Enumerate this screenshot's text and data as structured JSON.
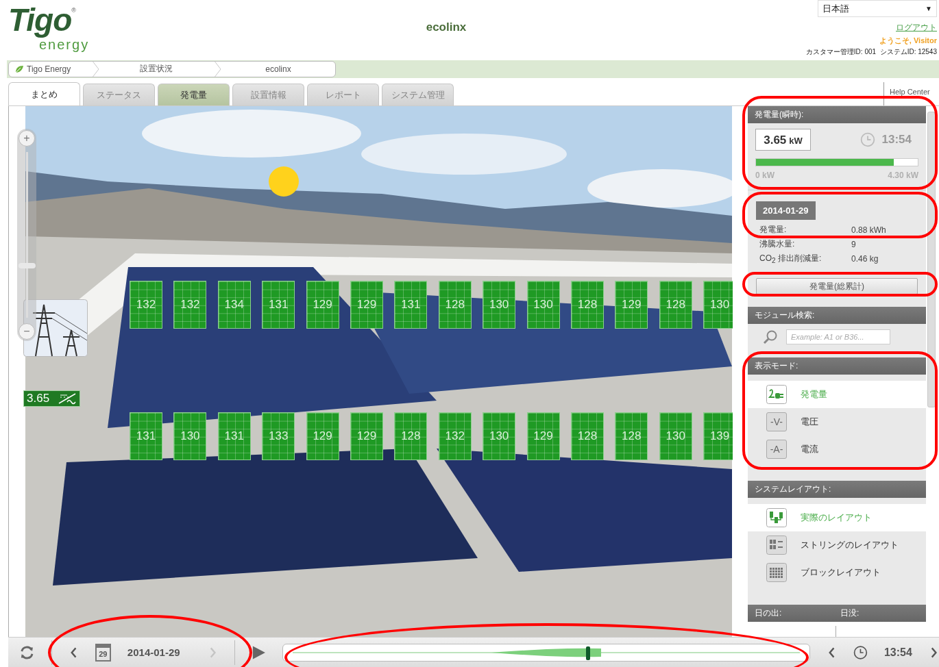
{
  "header": {
    "logo": {
      "wordmark": "Tigo",
      "registered": "®",
      "tagline": "energy"
    },
    "title": "ecolinx",
    "language": "日本語",
    "language_caret": "▼",
    "logout": "ログアウト",
    "welcome": "ようこそ, Visitor",
    "ids": "カスタマー管理ID: 001  システムID: 12543"
  },
  "breadcrumb": [
    "Tigo Energy",
    "設置状況",
    "ecolinx"
  ],
  "tabs": [
    {
      "label": "まとめ",
      "selected": true,
      "highlighted": false,
      "disabled": false
    },
    {
      "label": "ステータス",
      "selected": false,
      "highlighted": false,
      "disabled": true
    },
    {
      "label": "発電量",
      "selected": false,
      "highlighted": true,
      "disabled": false
    },
    {
      "label": "設置情報",
      "selected": false,
      "highlighted": false,
      "disabled": true
    },
    {
      "label": "レポート",
      "selected": false,
      "highlighted": false,
      "disabled": true
    },
    {
      "label": "システム管理",
      "selected": false,
      "highlighted": false,
      "disabled": true
    }
  ],
  "help_center": "Help Center",
  "map": {
    "zoom": {
      "plus": "+",
      "minus": "−",
      "level": 0.3
    },
    "power_badge": "3.65",
    "module_rows": [
      [
        "132",
        "132",
        "134",
        "131",
        "129",
        "129",
        "131",
        "128",
        "130",
        "130",
        "128",
        "129",
        "128",
        "130"
      ],
      [
        "131",
        "130",
        "131",
        "133",
        "129",
        "129",
        "128",
        "132",
        "130",
        "129",
        "128",
        "128",
        "130",
        "139"
      ]
    ]
  },
  "panel": {
    "instant": {
      "heading": "発電量(瞬時):",
      "value": "3.65",
      "unit": "kW",
      "time": "13:54",
      "level": 0.85,
      "min_label": "0 kW",
      "max_label": "4.30 kW"
    },
    "daily": {
      "date": "2014-01-29",
      "rows": [
        {
          "label": "発電量:",
          "value": "0.88 kWh"
        },
        {
          "label": "沸騰水量:",
          "value": "9"
        },
        {
          "label": "CO$_{2}$ 排出削減量:",
          "value": "0.46 kg"
        }
      ]
    },
    "total_button": "発電量(総累計)",
    "module_search": {
      "heading": "モジュール検索:",
      "placeholder": "Example: A1 or B36..."
    },
    "display_mode": {
      "heading": "表示モード:",
      "items": [
        {
          "kind": "plug",
          "label": "発電量",
          "selected": true
        },
        {
          "kind": "text",
          "icon_text": "-V-",
          "label": "電圧",
          "selected": false
        },
        {
          "kind": "text",
          "icon_text": "-A-",
          "label": "電流",
          "selected": false
        }
      ]
    },
    "system_layout": {
      "heading": "システムレイアウト:",
      "items": [
        {
          "kind": "actual",
          "label": "実際のレイアウト",
          "selected": true
        },
        {
          "kind": "string",
          "label": "ストリングのレイアウト",
          "selected": false
        },
        {
          "kind": "block",
          "label": "ブロックレイアウト",
          "selected": false
        }
      ]
    },
    "sun": {
      "sunrise_label": "日の出:",
      "sunset_label": "日没:"
    }
  },
  "bottom": {
    "calendar_day": "29",
    "date": "2014-01-29",
    "next_date_disabled": true,
    "timeline": {
      "level": 0.576
    },
    "time": "13:54"
  }
}
